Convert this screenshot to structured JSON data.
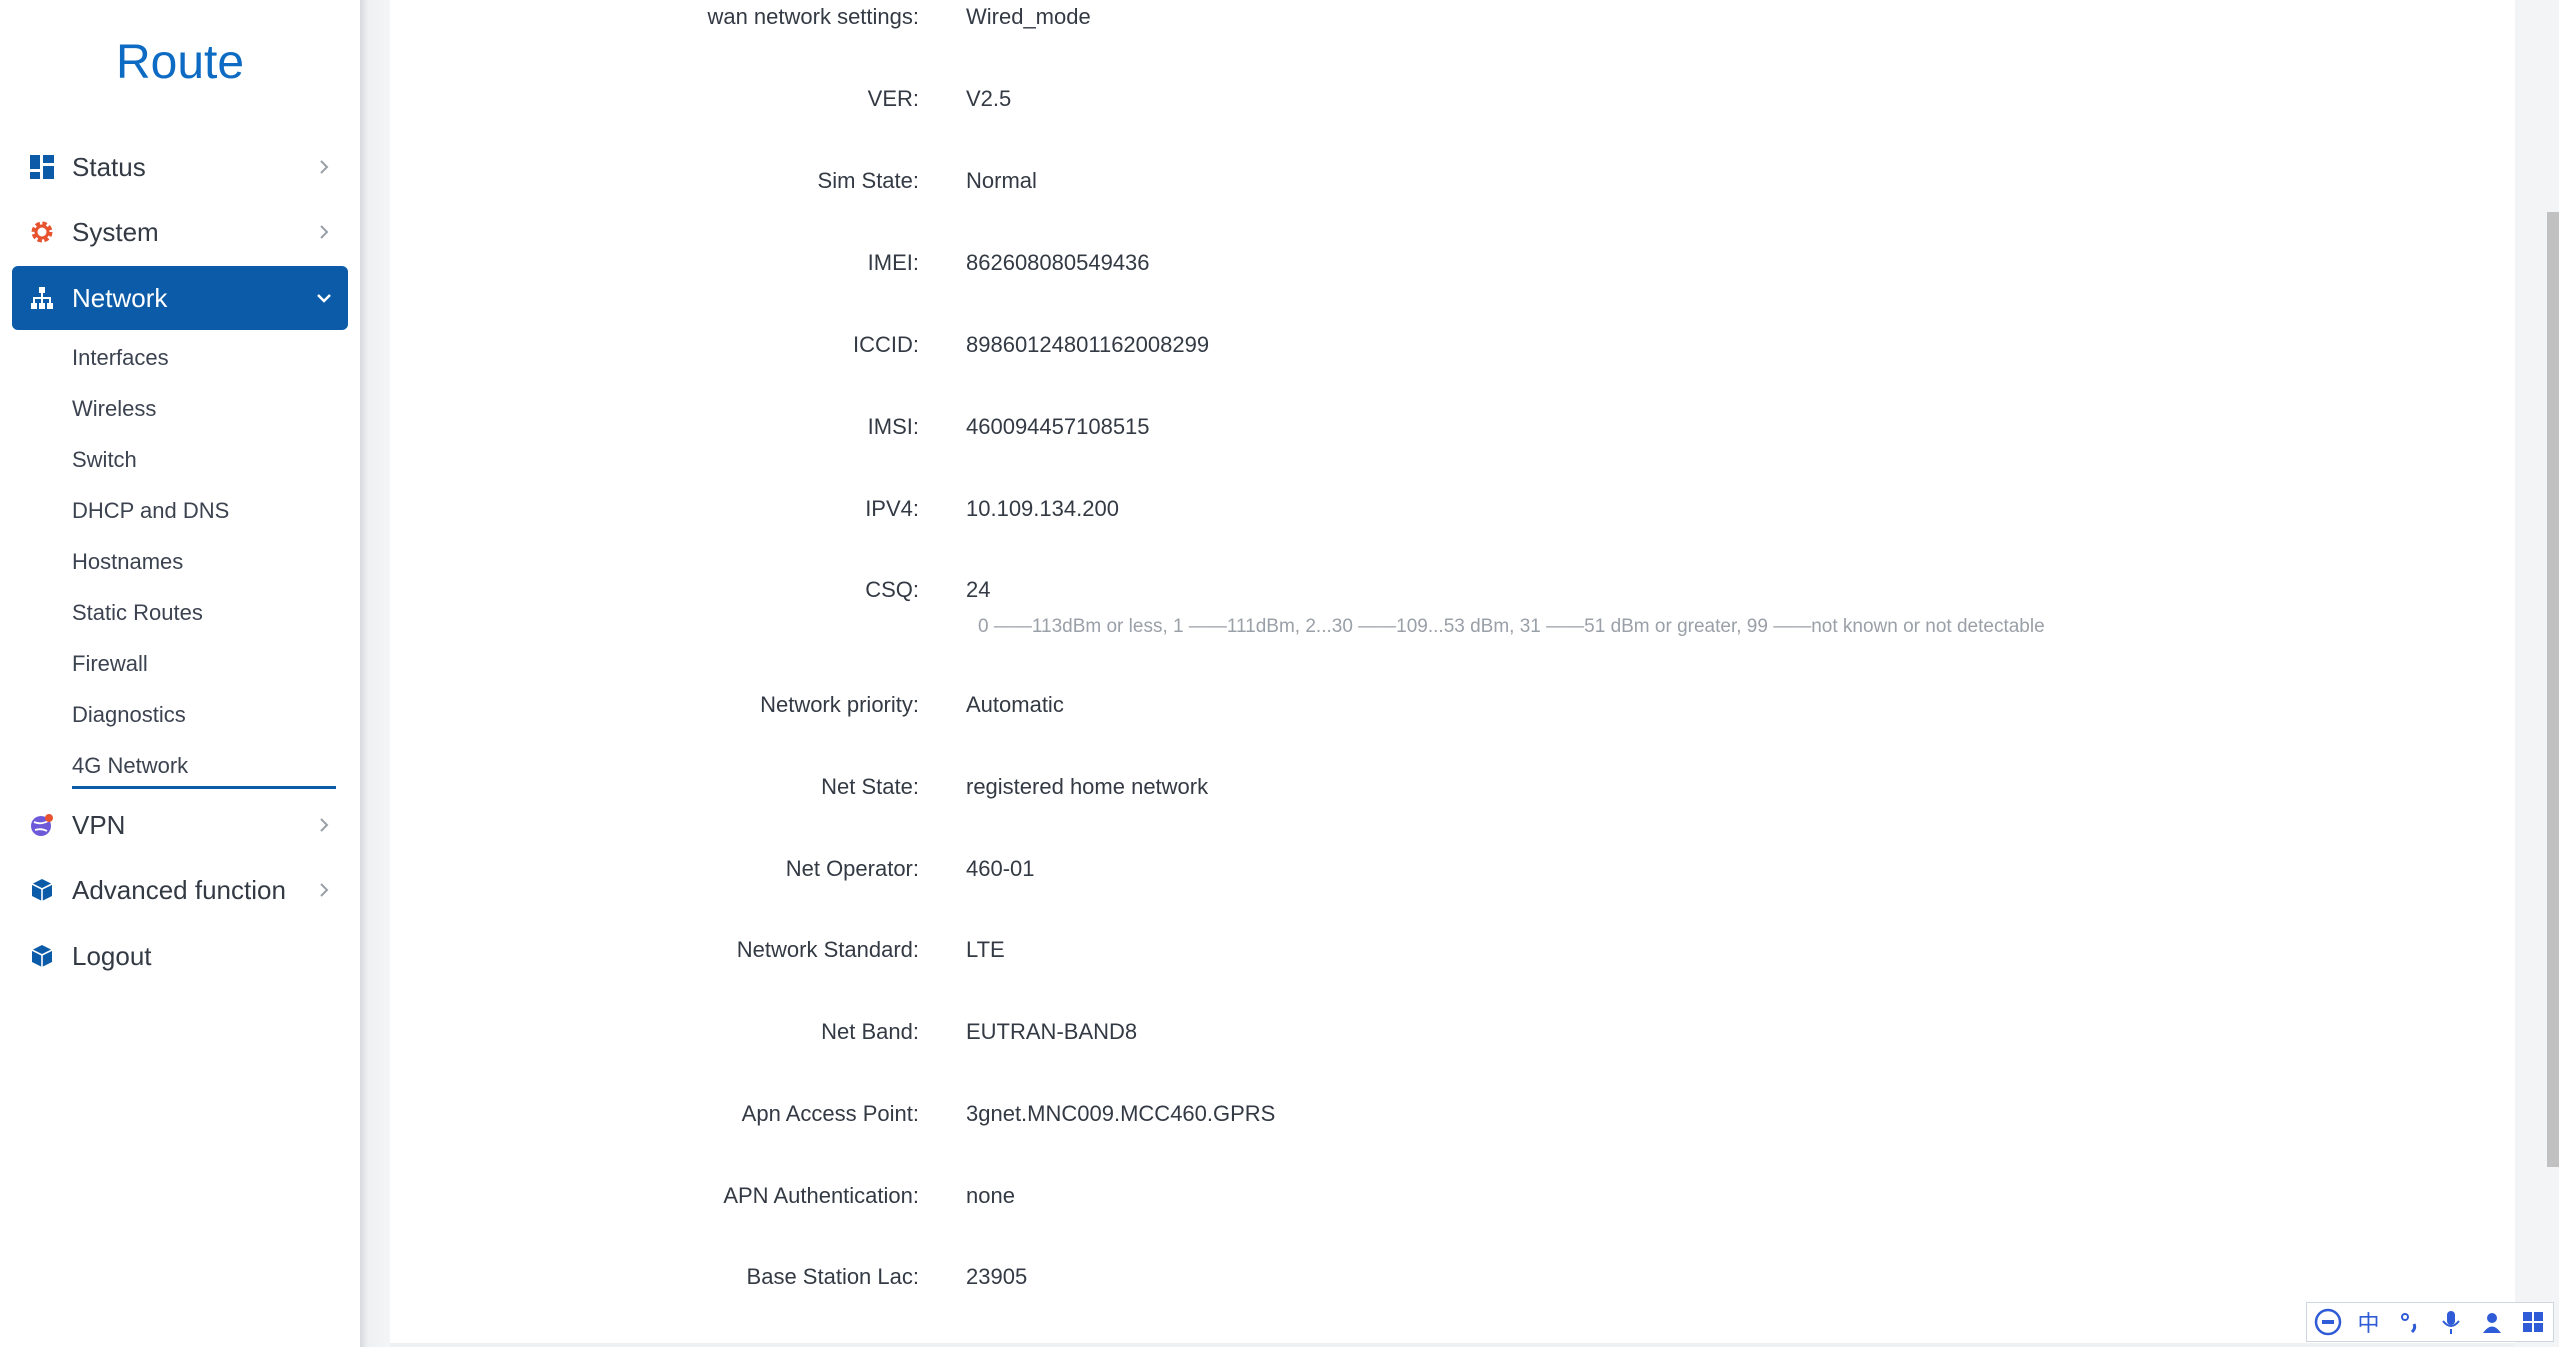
{
  "sidebar": {
    "brand": "Route",
    "items": [
      {
        "label": "Status",
        "icon": "dashboard-icon"
      },
      {
        "label": "System",
        "icon": "gear-icon"
      },
      {
        "label": "Network",
        "icon": "network-icon"
      },
      {
        "label": "VPN",
        "icon": "globe-icon"
      },
      {
        "label": "Advanced function",
        "icon": "cube-icon"
      },
      {
        "label": "Logout",
        "icon": "cube-icon"
      }
    ],
    "network_sub": [
      "Interfaces",
      "Wireless",
      "Switch",
      "DHCP and DNS",
      "Hostnames",
      "Static Routes",
      "Firewall",
      "Diagnostics",
      "4G Network"
    ]
  },
  "rows": [
    {
      "label": "wan network settings:",
      "value": "Wired_mode"
    },
    {
      "label": "VER:",
      "value": "V2.5"
    },
    {
      "label": "Sim State:",
      "value": "Normal"
    },
    {
      "label": "IMEI:",
      "value": "862608080549436"
    },
    {
      "label": "ICCID:",
      "value": "89860124801162008299"
    },
    {
      "label": "IMSI:",
      "value": "460094457108515"
    },
    {
      "label": "IPV4:",
      "value": "10.109.134.200"
    },
    {
      "label": "CSQ:",
      "value": "24"
    },
    {
      "label": "Network priority:",
      "value": "Automatic"
    },
    {
      "label": "Net State:",
      "value": "registered home network"
    },
    {
      "label": "Net Operator:",
      "value": "460-01"
    },
    {
      "label": "Network Standard:",
      "value": "LTE"
    },
    {
      "label": "Net Band:",
      "value": "EUTRAN-BAND8"
    },
    {
      "label": "Apn Access Point:",
      "value": "3gnet.MNC009.MCC460.GPRS"
    },
    {
      "label": "APN Authentication:",
      "value": "none"
    },
    {
      "label": "Base Station Lac:",
      "value": "23905"
    }
  ],
  "csq_hint": "0 ——113dBm or less, 1 ——111dBm, 2...30 ——109...53 dBm, 31 ——51 dBm or greater, 99 ——not known or not detectable",
  "ime": {
    "buttons": [
      "ifly-logo-icon",
      "chinese-mode-icon",
      "punctuation-icon",
      "microphone-icon",
      "user-icon",
      "apps-grid-icon"
    ],
    "chinese_label": "中"
  },
  "colors": {
    "accent": "#0b5ba8",
    "brand": "#0d6bc4",
    "hint": "#9aa0a8"
  }
}
